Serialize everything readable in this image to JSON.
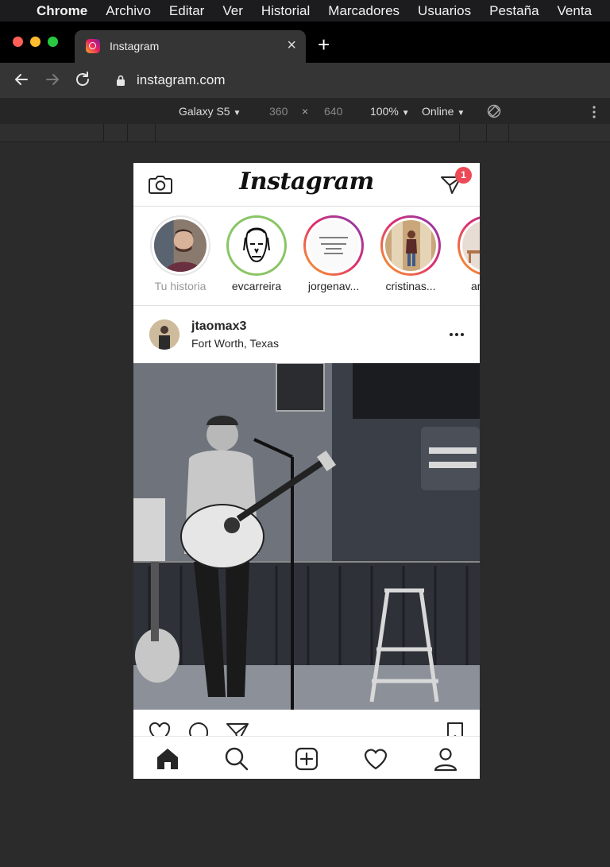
{
  "menubar": {
    "app": "Chrome",
    "items": [
      "Archivo",
      "Editar",
      "Ver",
      "Historial",
      "Marcadores",
      "Usuarios",
      "Pestaña",
      "Venta"
    ]
  },
  "tab": {
    "title": "Instagram",
    "close": "×",
    "new_tab": "+"
  },
  "address": {
    "url": "instagram.com"
  },
  "devtools": {
    "device": "Galaxy S5",
    "width": "360",
    "times": "×",
    "height": "640",
    "zoom": "100%",
    "network": "Online",
    "caret": "▼"
  },
  "instagram": {
    "logo": "Instagram",
    "dm_badge": "1",
    "stories": [
      {
        "label": "Tu historia",
        "ring": "none"
      },
      {
        "label": "evcarreira",
        "ring": "green"
      },
      {
        "label": "jorgenav...",
        "ring": "gradient"
      },
      {
        "label": "cristinas...",
        "ring": "gradient"
      },
      {
        "label": "ar",
        "ring": "gradient"
      }
    ],
    "post": {
      "username": "jtaomax3",
      "location": "Fort Worth, Texas"
    },
    "colors": {
      "story_green": "#8ac565",
      "badge": "#ed4956"
    }
  }
}
